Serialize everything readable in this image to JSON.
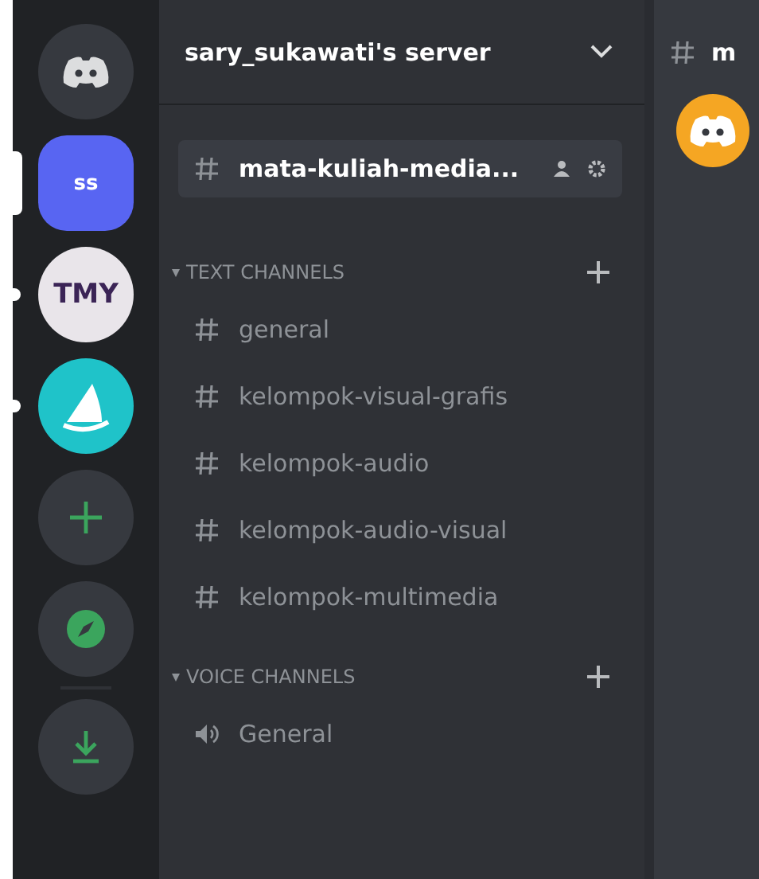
{
  "servers": [
    {
      "kind": "home",
      "selected": false
    },
    {
      "kind": "initials",
      "label": "ss",
      "selected": true
    },
    {
      "kind": "initials",
      "label": "TMY",
      "selected": false,
      "unread": true
    },
    {
      "kind": "picture",
      "selected": false,
      "unread": true
    },
    {
      "kind": "add",
      "selected": false
    },
    {
      "kind": "explore",
      "selected": false
    },
    {
      "kind": "download",
      "selected": false
    }
  ],
  "sidebar": {
    "server_name": "sary_sukawati's server",
    "channels": [
      {
        "kind": "text",
        "name": "mata-kuliah-media...",
        "selected": true
      }
    ],
    "categories": [
      {
        "name": "TEXT CHANNELS",
        "channels": [
          {
            "kind": "text",
            "name": "general",
            "selected": false
          },
          {
            "kind": "text",
            "name": "kelompok-visual-grafis",
            "selected": false
          },
          {
            "kind": "text",
            "name": "kelompok-audio",
            "selected": false
          },
          {
            "kind": "text",
            "name": "kelompok-audio-visual",
            "selected": false
          },
          {
            "kind": "text",
            "name": "kelompok-multimedia",
            "selected": false
          }
        ]
      },
      {
        "name": "VOICE CHANNELS",
        "channels": [
          {
            "kind": "voice",
            "name": "General",
            "selected": false
          }
        ]
      }
    ]
  },
  "main": {
    "channel_name": "m"
  }
}
